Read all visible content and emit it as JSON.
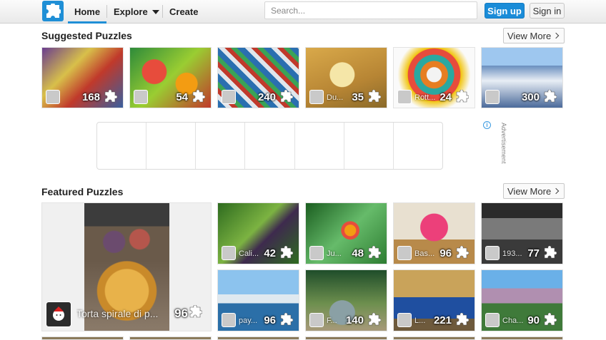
{
  "header": {
    "nav_home": "Home",
    "nav_explore": "Explore",
    "nav_create": "Create",
    "search_placeholder": "Search...",
    "signup_label": "Sign up",
    "signin_label": "Sign in"
  },
  "suggested": {
    "title": "Suggested Puzzles",
    "view_more": "View More",
    "items": [
      {
        "author": "",
        "count": "168"
      },
      {
        "author": "",
        "count": "54"
      },
      {
        "author": "",
        "count": "240"
      },
      {
        "author": "Du...",
        "count": "35"
      },
      {
        "author": "Rott...",
        "count": "24"
      },
      {
        "author": "",
        "count": "300"
      }
    ]
  },
  "ad": {
    "label": "Advertisement",
    "info": "i"
  },
  "featured": {
    "title": "Featured Puzzles",
    "view_more": "View More",
    "large": {
      "author": "Torta spirale di p...",
      "count": "96"
    },
    "items": [
      {
        "author": "Cali...",
        "count": "42"
      },
      {
        "author": "Ju...",
        "count": "48"
      },
      {
        "author": "Bas...",
        "count": "96"
      },
      {
        "author": "193...",
        "count": "77"
      },
      {
        "author": "pay...",
        "count": "96"
      },
      {
        "author": "F...",
        "count": "140"
      },
      {
        "author": "L...",
        "count": "221"
      },
      {
        "author": "Cha...",
        "count": "90"
      }
    ]
  },
  "colors": {
    "accent": "#1f8fd6",
    "signup": "#1a8cd8"
  }
}
